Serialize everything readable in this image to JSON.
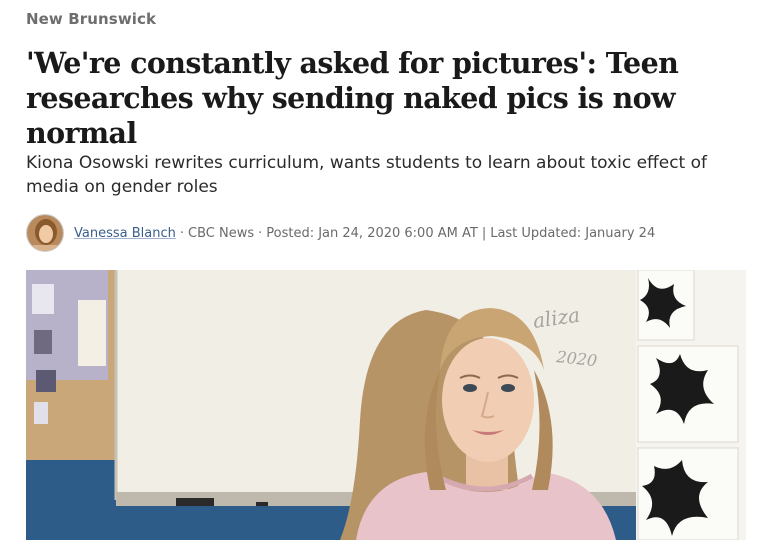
{
  "section": {
    "label": "New Brunswick"
  },
  "article": {
    "headline": "'We're constantly asked for pictures': Teen researches why sending naked pics is now normal",
    "deck": "Kiona Osowski rewrites curriculum, wants students to learn about toxic effect of media on gender roles"
  },
  "byline": {
    "author": "Vanessa Blanch",
    "outlet": "CBC News",
    "posted": "Posted: Jan 24, 2020 6:00 AM AT",
    "updated": "Last Updated: January 24",
    "separator_dot": "·",
    "separator_bar": "|"
  },
  "hero": {
    "whiteboard_text_1": "aliza",
    "whiteboard_text_2": "2020"
  },
  "colors": {
    "author_link": "#3a5e8c",
    "section_label": "#6e6e6e",
    "headline": "#1a1a1a"
  }
}
